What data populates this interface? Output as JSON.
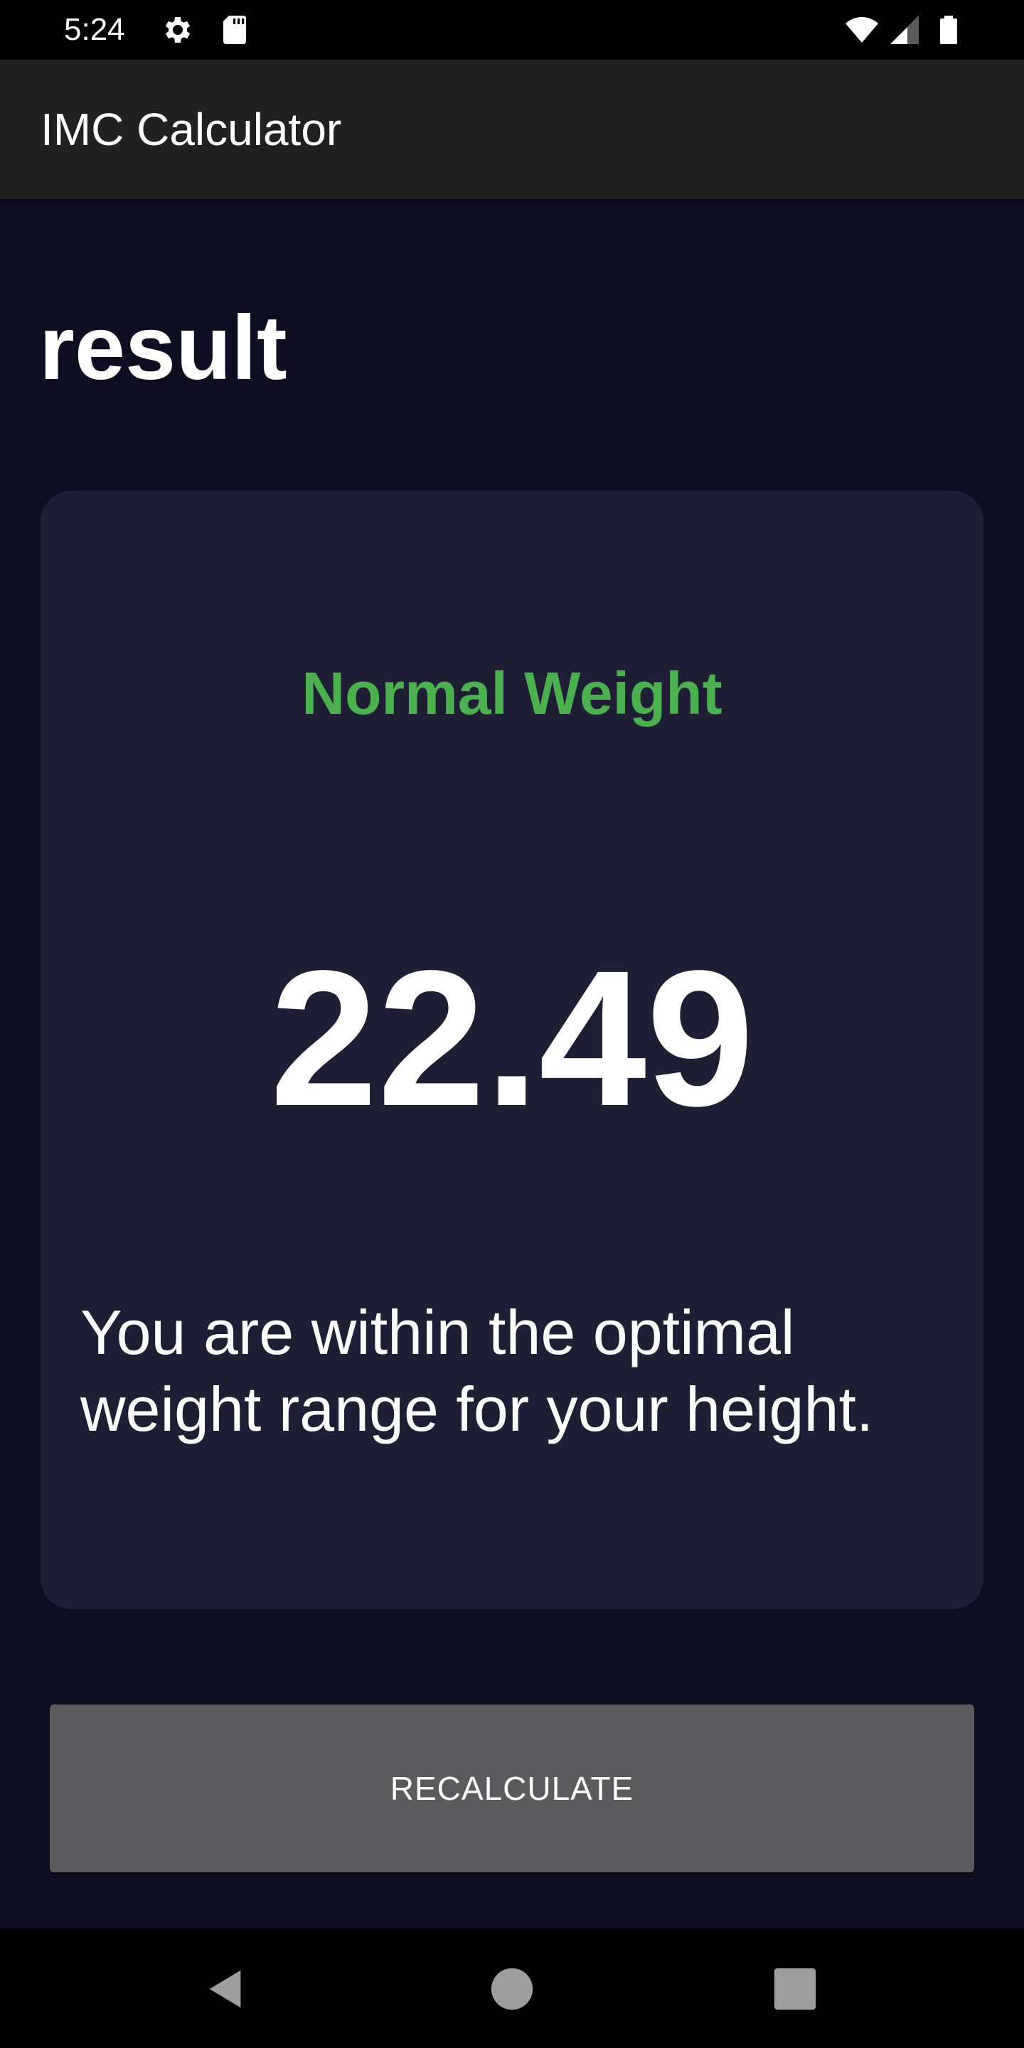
{
  "status_bar": {
    "time": "5:24",
    "icons": [
      "gear-icon",
      "sd-card-icon",
      "wifi-icon",
      "signal-icon",
      "battery-icon"
    ]
  },
  "app_bar": {
    "title": "IMC Calculator"
  },
  "main": {
    "heading": "result",
    "card": {
      "status_label": "Normal Weight",
      "status_color": "#4caf50",
      "bmi_value": "22.49",
      "description": "You are within the optimal weight range for your height."
    },
    "recalculate_label": "RECALCULATE"
  },
  "nav_bar": {
    "icons": [
      "back-icon",
      "home-icon",
      "recents-icon"
    ]
  },
  "colors": {
    "background": "#0f0d21",
    "card": "#1e1f35",
    "app_bar": "#212121",
    "button": "#5b5b5d",
    "accent_green": "#4caf50"
  }
}
